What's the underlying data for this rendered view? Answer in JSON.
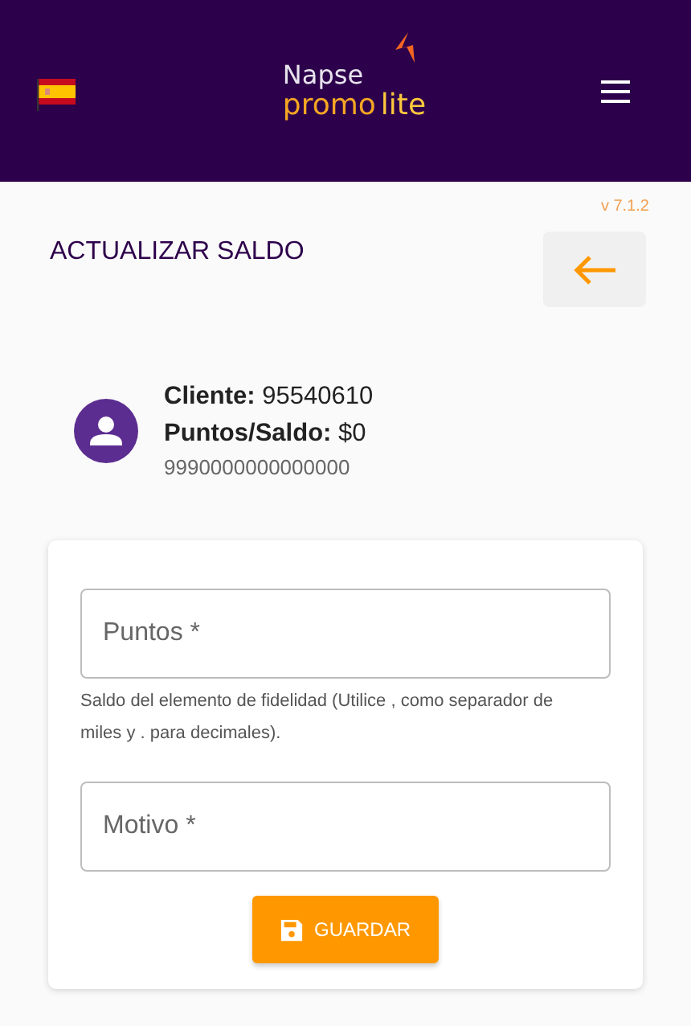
{
  "header": {
    "logo": {
      "top": "Napse",
      "bottom_left": "promo",
      "bottom_right": "lite"
    }
  },
  "version": "v 7.1.2",
  "page_title": "ACTUALIZAR SALDO",
  "customer": {
    "client_label": "Cliente:",
    "client_value": "95540610",
    "balance_label": "Puntos/Saldo:",
    "balance_value": "$0",
    "card_number": "9990000000000000"
  },
  "form": {
    "fields": [
      {
        "placeholder": "Puntos *",
        "hint": "Saldo del elemento de fidelidad (Utilice , como separador de miles y . para decimales)."
      },
      {
        "placeholder": "Motivo *"
      }
    ],
    "save_button": "GUARDAR"
  }
}
